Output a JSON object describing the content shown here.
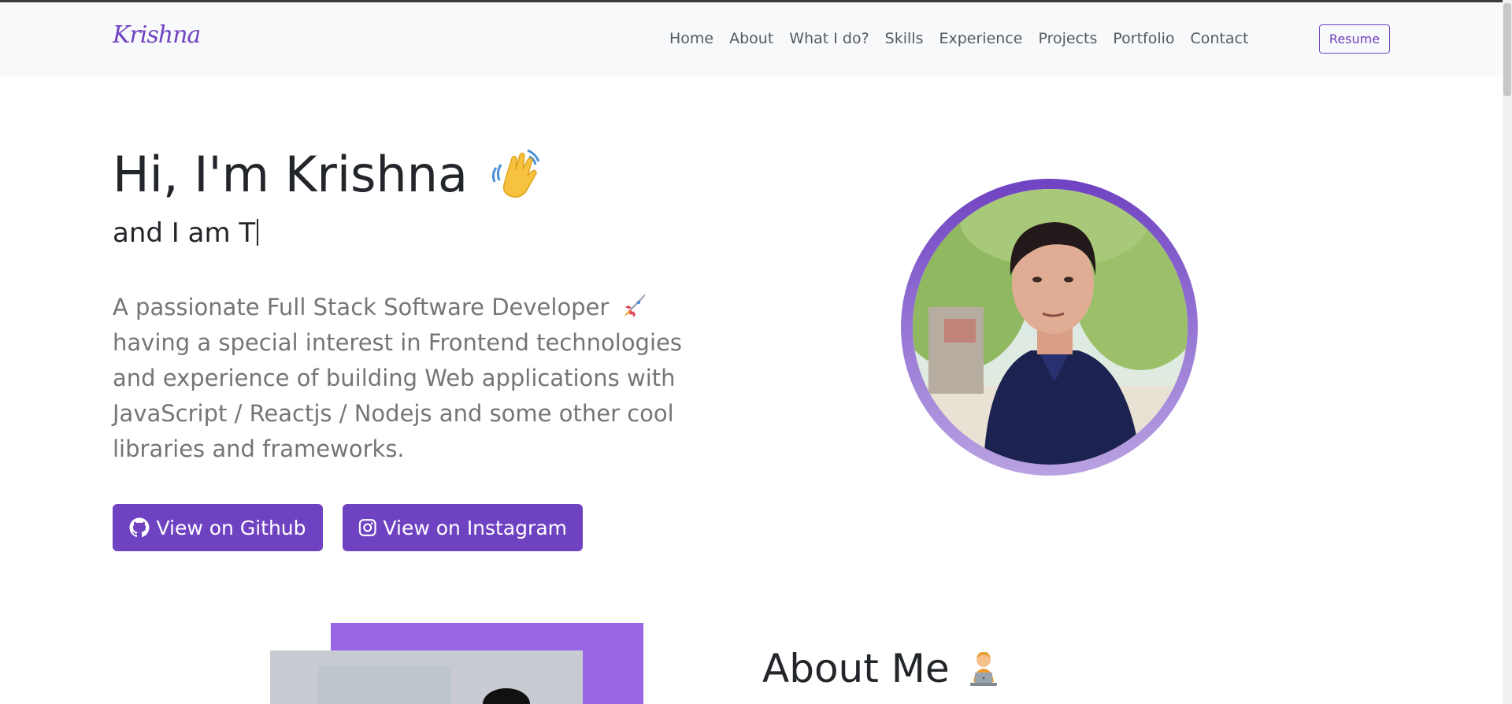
{
  "brand": {
    "name": "Krishna"
  },
  "nav": {
    "links": [
      "Home",
      "About",
      "What I do?",
      "Skills",
      "Experience",
      "Projects",
      "Portfolio",
      "Contact"
    ],
    "resume": "Resume"
  },
  "hero": {
    "greeting": "Hi, I'm Krishna",
    "typed_text": "and I am T",
    "description": "A passionate Full Stack Software Developer",
    "description_rest": "having a special interest in Frontend technologies and experience of building Web applications with JavaScript / Reactjs / Nodejs and some other cool libraries and frameworks.",
    "github_button": "View on Github",
    "instagram_button": "View on Instagram"
  },
  "about": {
    "title": "About Me"
  },
  "colors": {
    "accent": "#6f42c1",
    "accent_light": "#9966e6",
    "text": "#222529",
    "muted": "#737679"
  },
  "icons": [
    "waving-hand-emoji",
    "rocket-emoji",
    "github-icon",
    "instagram-icon",
    "technologist-emoji"
  ]
}
